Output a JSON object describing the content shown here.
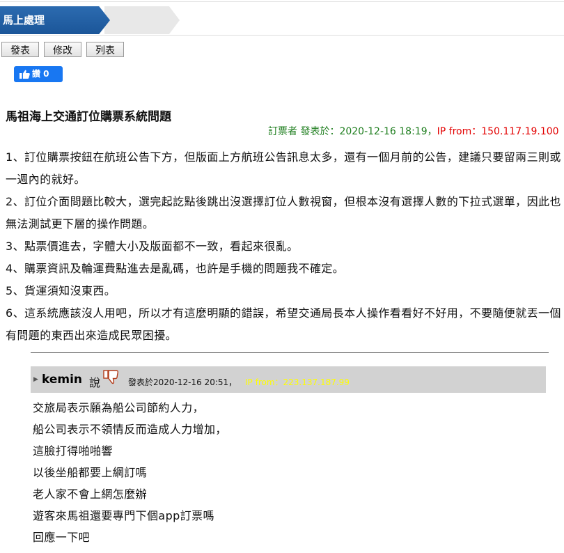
{
  "breadcrumb": {
    "current": "馬上處理"
  },
  "toolbar": {
    "post": "發表",
    "edit": "修改",
    "list": "列表"
  },
  "like_button": {
    "label": "讚 0"
  },
  "post": {
    "title": "馬祖海上交通訂位購票系統問題",
    "author": "訂票者",
    "posted_label": "發表於：",
    "datetime": "2020-12-16 18:19",
    "sep": "，",
    "ip_label": "IP from：",
    "ip": "150.117.19.100",
    "paragraphs": [
      "1、訂位購票按鈕在航班公告下方，但版面上方航班公告訊息太多，還有一個月前的公告，建議只要留兩三則或一週內的就好。",
      "2、訂位介面問題比較大，選完起訖點後跳出沒選擇訂位人數視窗，但根本沒有選擇人數的下拉式選單，因此也無法測試更下層的操作問題。",
      "3、點票價進去，字體大小及版面都不一致，看起來很亂。",
      "4、購票資訊及輪運費點進去是亂碼，也許是手機的問題我不確定。",
      "5、貨運須知沒東西。",
      "6、這系統應該沒人用吧，所以才有這麼明顯的錯誤，希望交通局長本人操作看看好不好用，不要隨便就丟一個有問題的東西出來造成民眾困擾。"
    ]
  },
  "reply": {
    "username": "kemin",
    "says": "說",
    "posted": "發表於2020-12-16 20:51，",
    "ip": "IP from：223.137.187.99",
    "lines": [
      "交旅局表示願為船公司節約人力，",
      "船公司表示不領情反而造成人力增加，",
      "這臉打得啪啪響",
      "以後坐船都要上網訂嗎",
      "老人家不會上網怎麼辦",
      "遊客來馬祖還要專門下個app訂票嗎",
      "回應一下吧"
    ]
  }
}
